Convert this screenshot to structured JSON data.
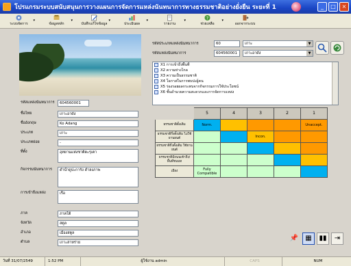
{
  "window": {
    "title": "โปรแกรมระบบสนับสนุนการวางแผนการจัดการแหล่งนันทนาการทางธรรมชาติอย่างยั่งยืน ระยะที่ 1"
  },
  "toolbar": [
    {
      "label": "ระบบจัดการ",
      "icon": "manage-icon"
    },
    {
      "label": "ข้อมูลหลัก",
      "icon": "data-icon"
    },
    {
      "label": "บันทึกแก้ไขข้อมูล",
      "icon": "edit-icon"
    },
    {
      "label": "ประเมินผล",
      "icon": "evaluate-icon"
    },
    {
      "label": "รายงาน",
      "icon": "report-icon"
    },
    {
      "label": "ช่วยเหลือ",
      "icon": "help-icon"
    },
    {
      "label": "ออกจากระบบ",
      "icon": "exit-icon"
    }
  ],
  "site_form": {
    "fields": [
      {
        "label": "รหัสแหล่งนันทนาการ",
        "value": "604560001"
      },
      {
        "label": "ชื่อไทย",
        "value": "เกาะอาดัง"
      },
      {
        "label": "ชื่ออังกฤษ",
        "value": "Ko Adang"
      },
      {
        "label": "ประเภท",
        "value": "เกาะ"
      },
      {
        "label": "ประเภทย่อย",
        "value": "-"
      },
      {
        "label": "ที่ตั้ง",
        "value": "อุทยานแห่งชาติตะรุเตา"
      },
      {
        "label": "กิจกรรมนันทนาการ",
        "value": "ดำน้ำดูปะการัง ดำลงภาพ"
      },
      {
        "label": "การเข้าถึงแหล่ง",
        "value": "เรือ"
      },
      {
        "label": "ภาค",
        "value": "ภาคใต้"
      },
      {
        "label": "จังหวัด",
        "value": "สตูล"
      },
      {
        "label": "อำเภอ",
        "value": "เมืองสตูล"
      },
      {
        "label": "ตำบล",
        "value": "เกาะสาหร่าย"
      }
    ]
  },
  "selector": {
    "type_label": "รหัสประเภทแหล่งนันทนาการ",
    "type_code": "60",
    "type_name": "เกาะ",
    "site_label": "รหัสแหล่งนันทนาการ",
    "site_code": "604560001",
    "site_name": "เกาะอาดัง"
  },
  "criteria": [
    "X1 การเข้าถึงพื้นที่",
    "X2 ความห่างไกล",
    "X3 ความเป็นธรรมชาติ",
    "X4 โอกาสในการพบปะผู้คน",
    "X5 ร่องรอยผลกระทบจากกิจกรรมการใช้ประโยชน์",
    "X6 ชั้นอำนวยความสะดวกและการจัดการแหล่ง"
  ],
  "matrix": {
    "col_headers": [
      "5",
      "4",
      "3",
      "2",
      "1"
    ],
    "rows": [
      {
        "label": "ธรรมชาติดั้งเดิม",
        "cells": [
          {
            "text": "Norm.",
            "color": "#00b0f0"
          },
          {
            "text": "",
            "color": "#ffc000"
          },
          {
            "text": "",
            "color": "#ff9900"
          },
          {
            "text": "",
            "color": "#ff9900"
          },
          {
            "text": "Unaccept.",
            "color": "#ff9900"
          }
        ]
      },
      {
        "label": "ธรรมชาติกึ่งดั้งเดิม ไม่ใช้ยานยนต์",
        "cells": [
          {
            "text": "",
            "color": "#ccffcc"
          },
          {
            "text": "",
            "color": "#00b0f0"
          },
          {
            "text": "Incon.",
            "color": "#ffc000"
          },
          {
            "text": "",
            "color": "#ff9900"
          },
          {
            "text": "",
            "color": "#ff9900"
          }
        ]
      },
      {
        "label": "ธรรมชาติกึ่งดั้งเดิม ใช้ยานยนต์",
        "cells": [
          {
            "text": "",
            "color": "#ccffcc"
          },
          {
            "text": "",
            "color": "#ccffcc"
          },
          {
            "text": "",
            "color": "#00b0f0"
          },
          {
            "text": "",
            "color": "#ffc000"
          },
          {
            "text": "",
            "color": "#ff9900"
          }
        ]
      },
      {
        "label": "ธรรมชาติมีถนนเข้าถึง/ พื้นที่ชนบท",
        "cells": [
          {
            "text": "",
            "color": "#ccffcc"
          },
          {
            "text": "",
            "color": "#ccffcc"
          },
          {
            "text": "",
            "color": "#ccffcc"
          },
          {
            "text": "",
            "color": "#00b0f0"
          },
          {
            "text": "",
            "color": "#ffc000"
          }
        ]
      },
      {
        "label": "เมือง",
        "cells": [
          {
            "text": "Fully Compatible",
            "color": "#ccffcc"
          },
          {
            "text": "",
            "color": "#ccffcc"
          },
          {
            "text": "",
            "color": "#ccffcc"
          },
          {
            "text": "",
            "color": "#ccffcc"
          },
          {
            "text": "",
            "color": "#00b0f0"
          }
        ]
      }
    ]
  },
  "statusbar": {
    "date": "วันที่ 31/07/2549",
    "time": "1:52 PM",
    "user": "ผู้ใช้งาน admin",
    "caps": "CAPS",
    "num": "NUM"
  }
}
